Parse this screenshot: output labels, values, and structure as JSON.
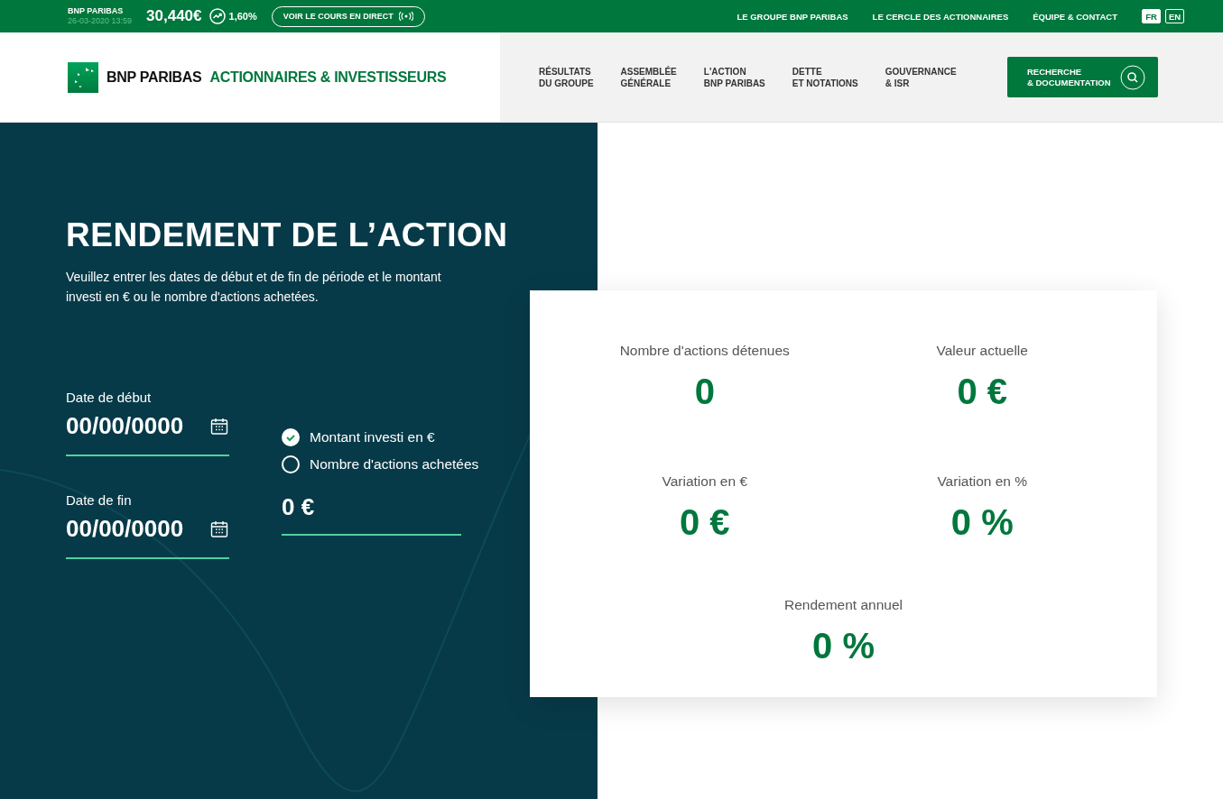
{
  "ticker": {
    "name": "BNP PARIBAS",
    "datetime": "26-03-2020 13:59",
    "price": "30,440€",
    "change": "1,60%",
    "live_button": "VOIR LE COURS EN DIRECT"
  },
  "top_links": [
    "LE GROUPE BNP PARIBAS",
    "LE CERCLE DES ACTIONNAIRES",
    "ÉQUIPE & CONTACT"
  ],
  "languages": [
    {
      "label": "FR",
      "selected": true
    },
    {
      "label": "EN",
      "selected": false
    }
  ],
  "header": {
    "brand": "BNP PARIBAS",
    "subtitle": "ACTIONNAIRES & INVESTISSEURS",
    "nav": [
      {
        "lines": [
          "RÉSULTATS",
          "DU GROUPE"
        ]
      },
      {
        "lines": [
          "ASSEMBLÉE",
          "GÉNÉRALE"
        ]
      },
      {
        "lines": [
          "L'ACTION",
          "BNP PARIBAS"
        ]
      },
      {
        "lines": [
          "DETTE",
          "ET NOTATIONS"
        ]
      },
      {
        "lines": [
          "GOUVERNANCE",
          "& ISR"
        ]
      }
    ],
    "search_button": [
      "RECHERCHE",
      "& DOCUMENTATION"
    ]
  },
  "form": {
    "title": "RENDEMENT DE L’ACTION",
    "intro": "Veuillez entrer les dates de début et de fin de période et le montant investi en €  ou le nombre d'actions achetées.",
    "dates": [
      {
        "label": "Date de début",
        "value": "00/00/0000"
      },
      {
        "label": "Date de fin",
        "value": "00/00/0000"
      }
    ],
    "options": [
      {
        "label": "Montant investi en €",
        "selected": true
      },
      {
        "label": "Nombre d'actions achetées",
        "selected": false
      }
    ],
    "amount": "0 €"
  },
  "results": [
    {
      "label": "Nombre d'actions détenues",
      "value": "0"
    },
    {
      "label": "Valeur actuelle",
      "value": "0 €"
    },
    {
      "label": "Variation en €",
      "value": "0 €"
    },
    {
      "label": "Variation en %",
      "value": "0 %"
    },
    {
      "label": "Rendement annuel",
      "value": "0 %"
    }
  ]
}
